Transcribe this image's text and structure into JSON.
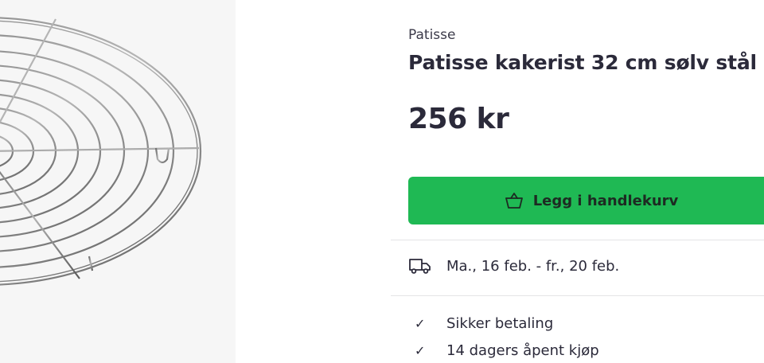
{
  "product": {
    "brand": "Patisse",
    "title": "Patisse kakerist 32 cm sølv stål",
    "price": "256 kr",
    "image_alt": "cake-cooling-rack"
  },
  "actions": {
    "add_to_cart_label": "Legg i handlekurv",
    "add_to_cart_icon": "basket-icon",
    "button_color": "#1fb954"
  },
  "delivery": {
    "icon": "delivery-truck-icon",
    "text": "Ma., 16 feb. - fr., 20 feb."
  },
  "usps": [
    {
      "icon": "check-icon",
      "text": "Sikker betaling"
    },
    {
      "icon": "check-icon",
      "text": "14 dagers åpent kjøp"
    }
  ]
}
